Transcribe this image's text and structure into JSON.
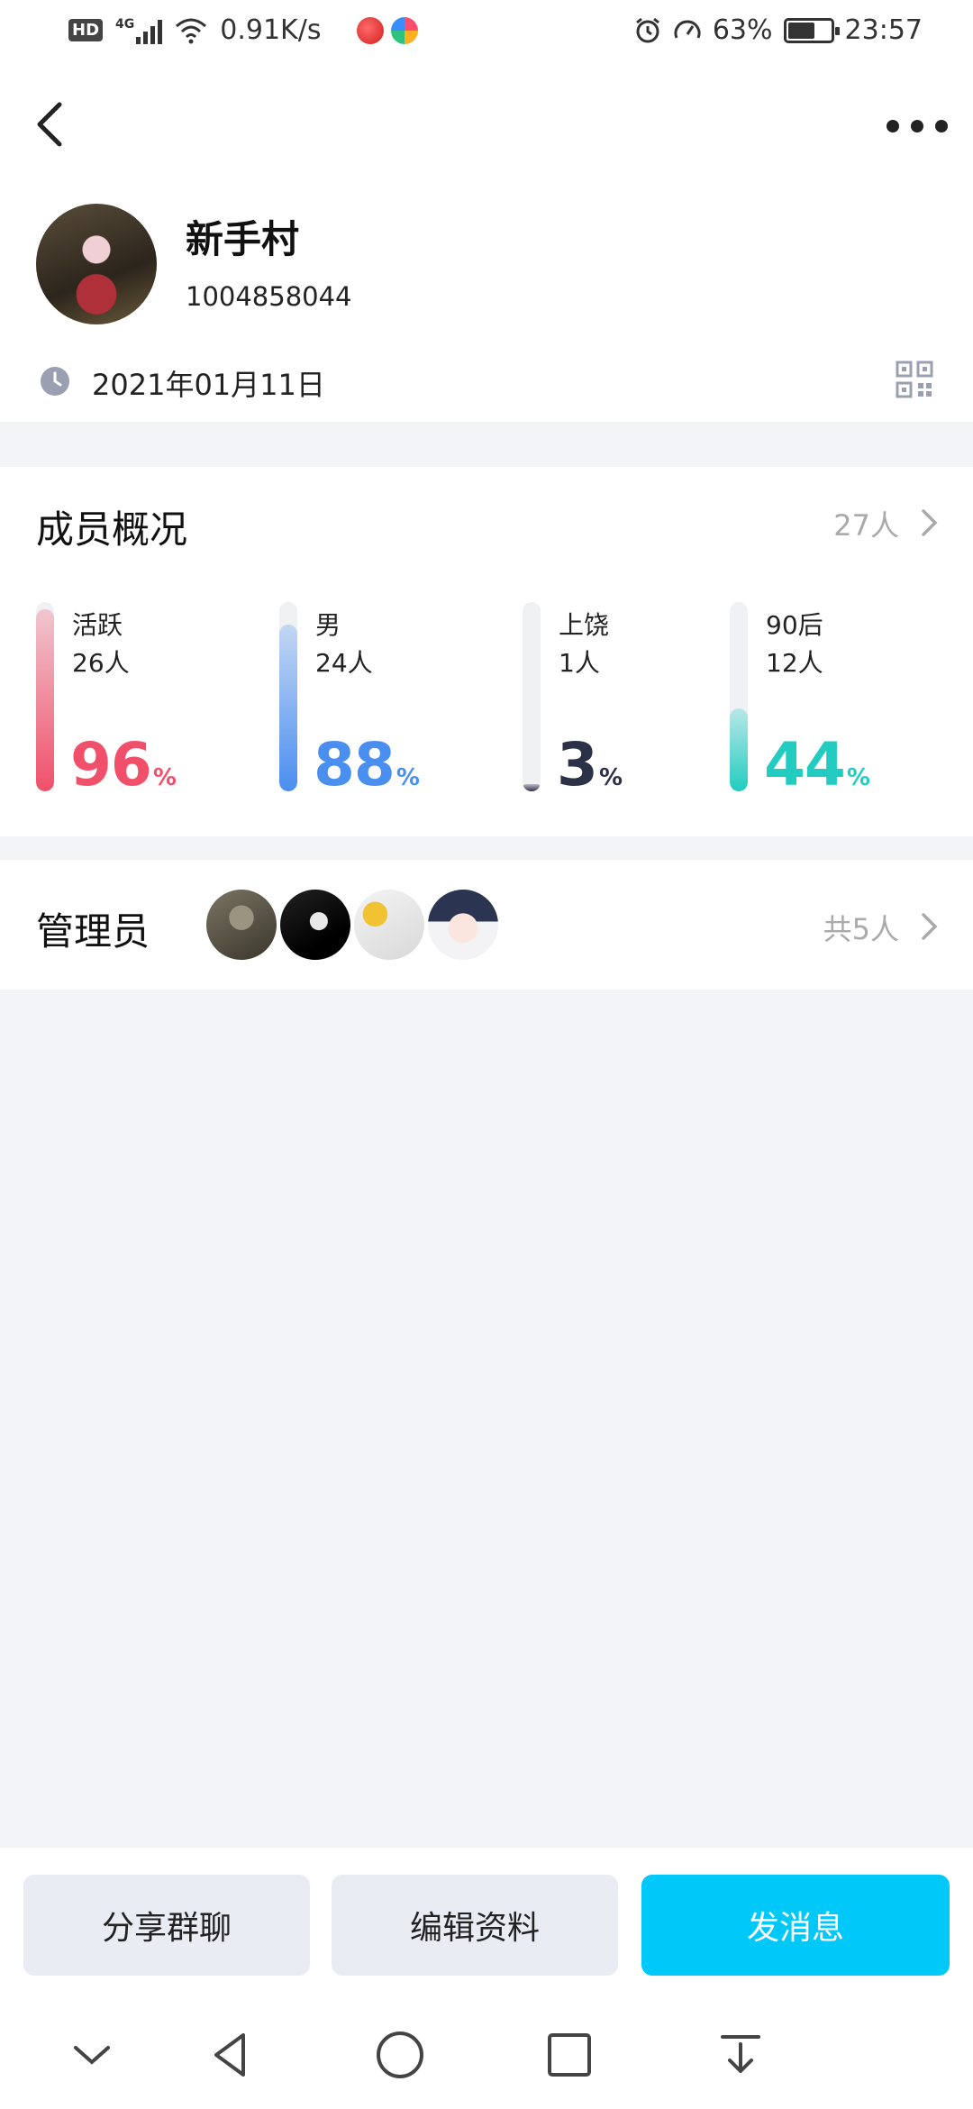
{
  "status_bar": {
    "network_badge": "HD",
    "signal_type": "4G",
    "speed": "0.91K/s",
    "battery_percent": "63%",
    "battery_level": 0.63,
    "time": "23:57"
  },
  "header": {
    "group_name": "新手村",
    "group_id": "1004858044",
    "created_date": "2021年01月11日"
  },
  "members": {
    "title": "成员概况",
    "count": "27人",
    "stats": [
      {
        "label": "活跃",
        "count": "26人",
        "percent": "96",
        "unit": "%",
        "color": "#f0506a",
        "fill_ratio": 0.96
      },
      {
        "label": "男",
        "count": "24人",
        "percent": "88",
        "unit": "%",
        "color": "#4a8ef0",
        "fill_ratio": 0.88
      },
      {
        "label": "上饶",
        "count": "1人",
        "percent": "3",
        "unit": "%",
        "color": "#2b3146",
        "fill_ratio": 0.03
      },
      {
        "label": "90后",
        "count": "12人",
        "percent": "44",
        "unit": "%",
        "color": "#22ccc0",
        "fill_ratio": 0.44
      }
    ]
  },
  "admins": {
    "title": "管理员",
    "count": "共5人"
  },
  "actions": {
    "share": "分享群聊",
    "edit": "编辑资料",
    "message": "发消息"
  }
}
